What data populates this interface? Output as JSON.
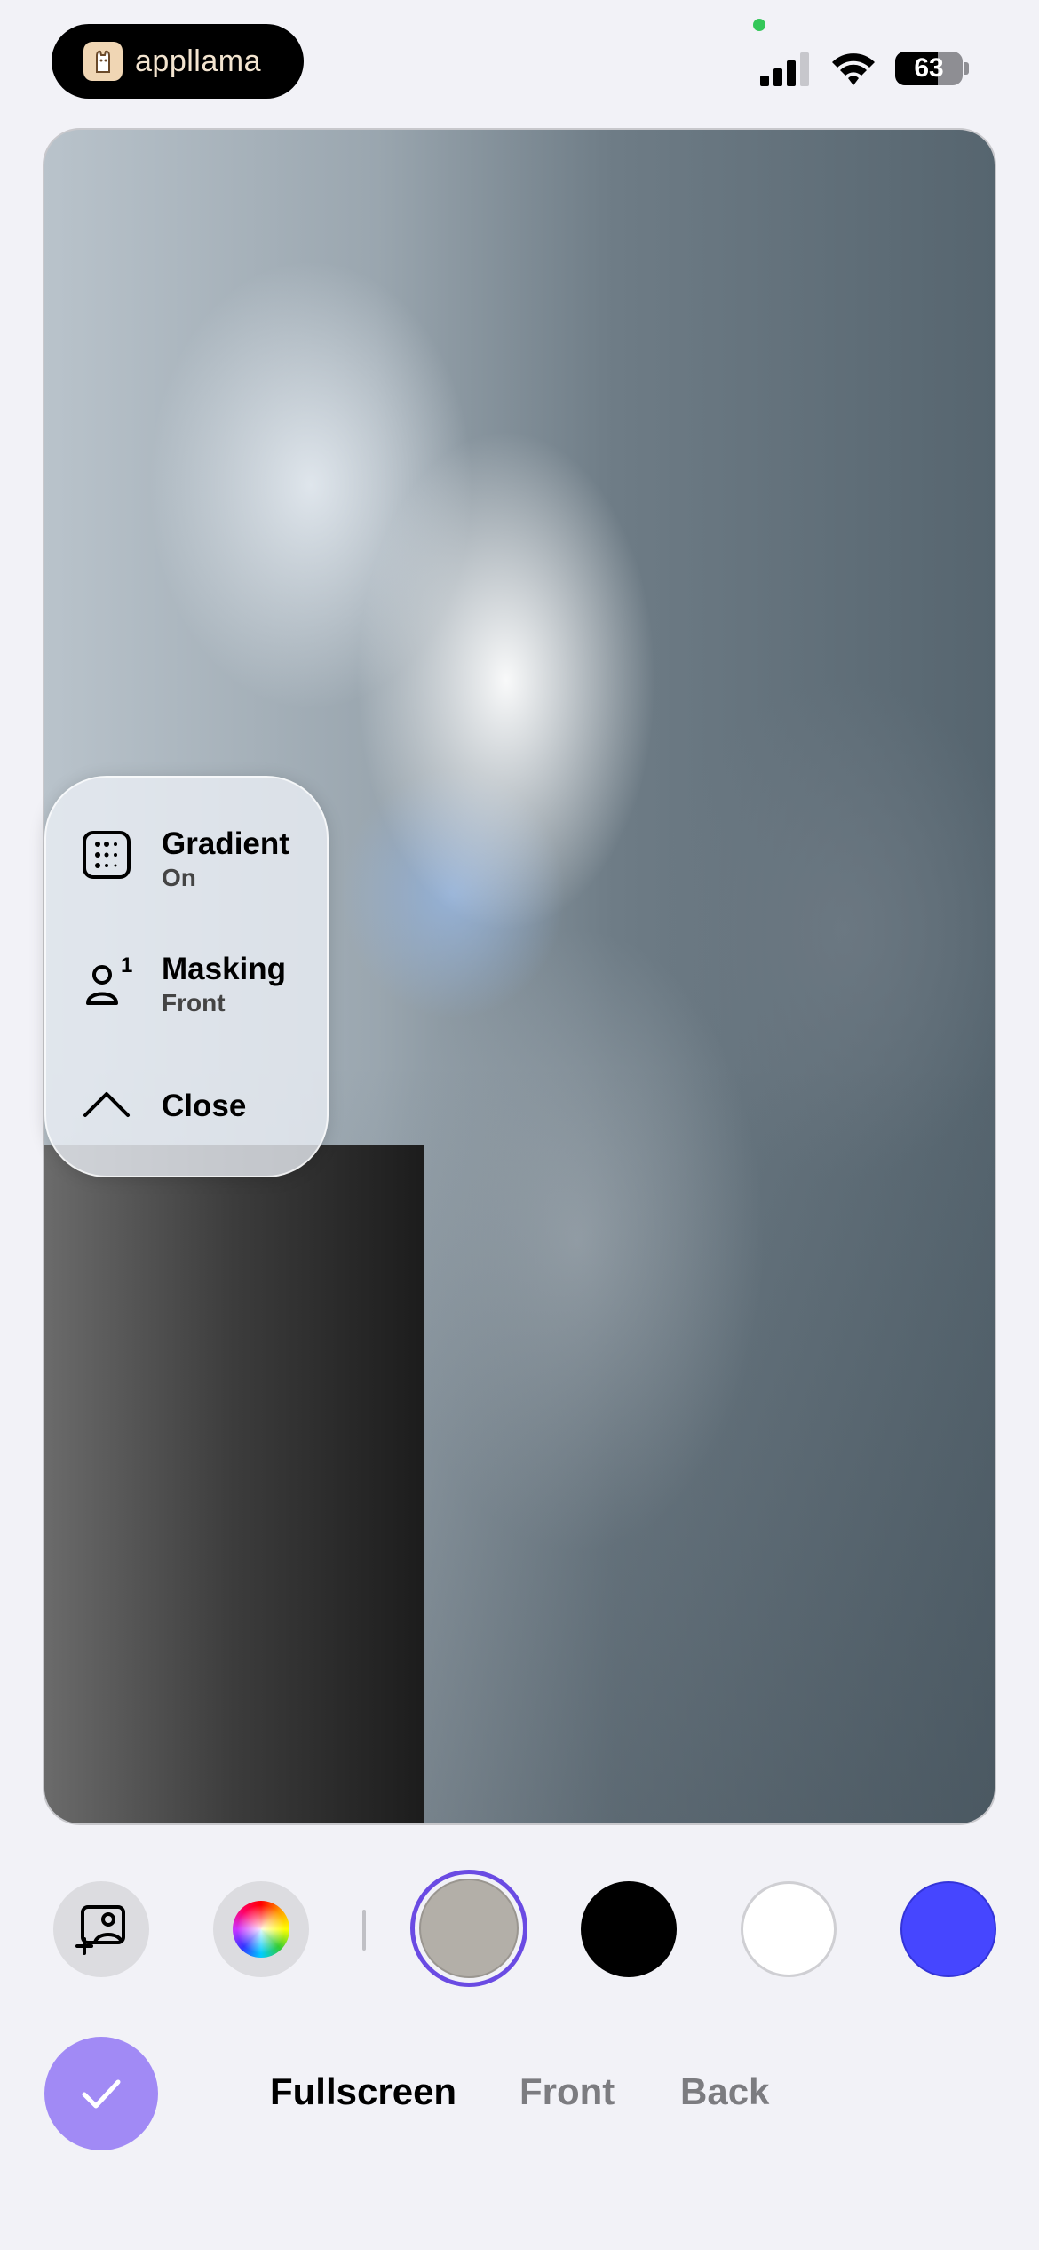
{
  "status_bar": {
    "app_name": "appllama",
    "battery": "63",
    "battery_level": 0.63
  },
  "menu": {
    "gradient": {
      "title": "Gradient",
      "value": "On"
    },
    "masking": {
      "title": "Masking",
      "value": "Front",
      "badge": "1"
    },
    "close": {
      "label": "Close"
    }
  },
  "colors": {
    "accent": "#6a4be3",
    "confirm": "#a18af5",
    "swatches": [
      "#b3afa8",
      "#000000",
      "#ffffff",
      "#4646ff"
    ],
    "selected_index": 0
  },
  "tabs": [
    {
      "label": "Fullscreen",
      "active": true
    },
    {
      "label": "Front",
      "active": false
    },
    {
      "label": "Back",
      "active": false
    }
  ],
  "icons": [
    "add-photo-icon",
    "color-wheel-icon",
    "checkmark-icon",
    "chevron-up-icon",
    "person-icon",
    "gradient-dots-icon"
  ]
}
